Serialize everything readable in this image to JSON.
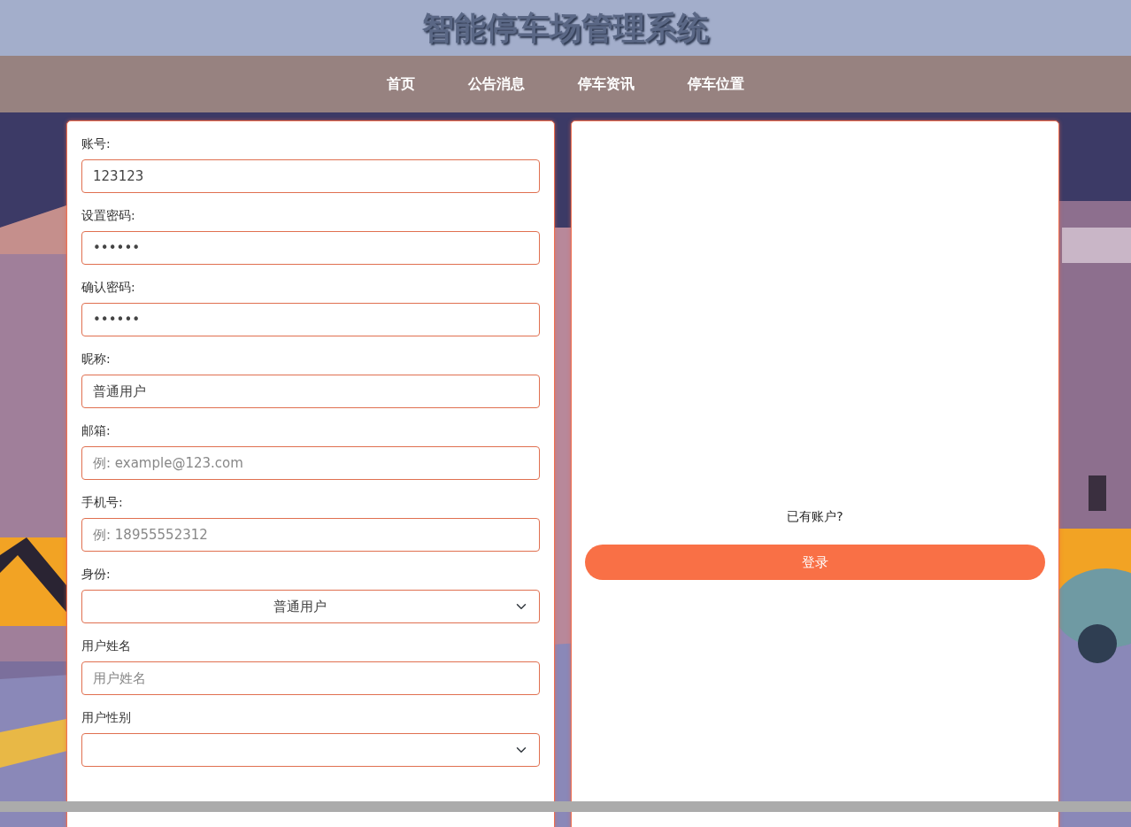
{
  "header": {
    "title": "智能停车场管理系统"
  },
  "nav": [
    {
      "label": "首页"
    },
    {
      "label": "公告消息"
    },
    {
      "label": "停车资讯"
    },
    {
      "label": "停车位置"
    }
  ],
  "register_form": {
    "fields": [
      {
        "kind": "text",
        "label": "账号:",
        "value": "123123"
      },
      {
        "kind": "text",
        "label": "设置密码:",
        "value": "••••••"
      },
      {
        "kind": "text",
        "label": "确认密码:",
        "value": "••••••"
      },
      {
        "kind": "text",
        "label": "昵称:",
        "value": "普通用户"
      },
      {
        "kind": "text",
        "label": "邮箱:",
        "placeholder": "例: example@123.com"
      },
      {
        "kind": "text",
        "label": "手机号:",
        "placeholder": "例: 18955552312"
      },
      {
        "kind": "select",
        "label": "身份:",
        "value": "普通用户"
      },
      {
        "kind": "text",
        "label": "用户姓名",
        "placeholder": "用户姓名"
      },
      {
        "kind": "select",
        "label": "用户性别"
      }
    ]
  },
  "login_panel": {
    "prompt": "已有账户?",
    "button": "登录"
  }
}
